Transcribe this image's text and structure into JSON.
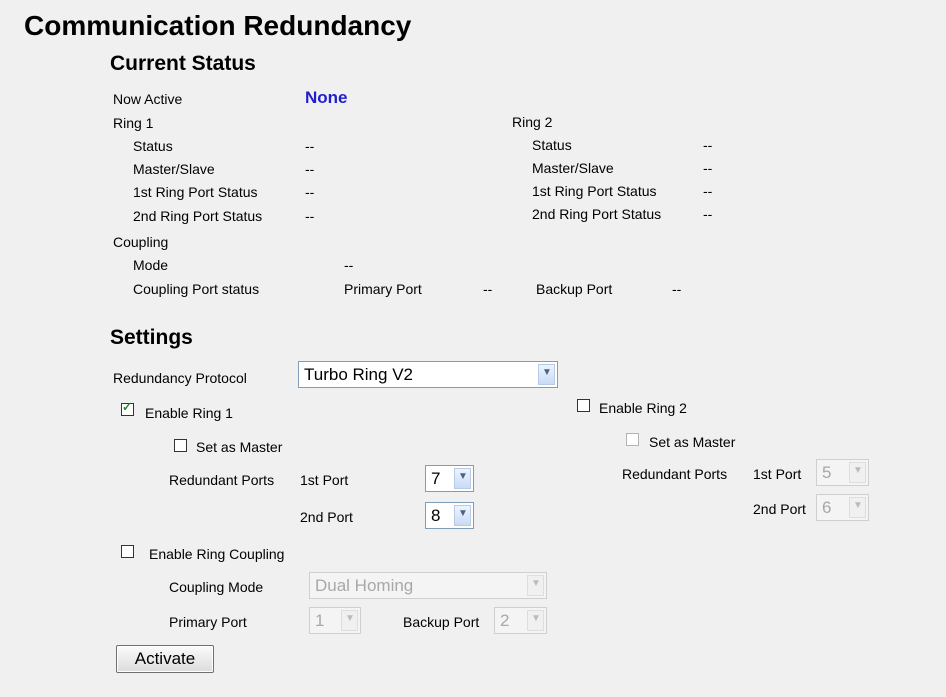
{
  "title": "Communication Redundancy",
  "status": {
    "heading": "Current Status",
    "now_active_label": "Now Active",
    "now_active_value": "None",
    "ring1": {
      "label": "Ring 1",
      "status_label": "Status",
      "status_value": "--",
      "master_label": "Master/Slave",
      "master_value": "--",
      "port1_label": "1st Ring Port Status",
      "port1_value": "--",
      "port2_label": "2nd Ring Port Status",
      "port2_value": "--"
    },
    "ring2": {
      "label": "Ring 2",
      "status_label": "Status",
      "status_value": "--",
      "master_label": "Master/Slave",
      "master_value": "--",
      "port1_label": "1st Ring Port Status",
      "port1_value": "--",
      "port2_label": "2nd Ring Port Status",
      "port2_value": "--"
    },
    "coupling": {
      "label": "Coupling",
      "mode_label": "Mode",
      "mode_value": "--",
      "port_status_label": "Coupling Port status",
      "primary_label": "Primary Port",
      "primary_value": "--",
      "backup_label": "Backup Port",
      "backup_value": "--"
    }
  },
  "settings": {
    "heading": "Settings",
    "protocol_label": "Redundancy Protocol",
    "protocol_value": "Turbo Ring V2",
    "ring1": {
      "enable_label": "Enable Ring 1",
      "enabled": true,
      "master_label": "Set as Master",
      "master_checked": false,
      "ports_label": "Redundant Ports",
      "first_label": "1st Port",
      "first_value": "7",
      "second_label": "2nd Port",
      "second_value": "8"
    },
    "ring2": {
      "enable_label": "Enable Ring 2",
      "enabled": false,
      "master_label": "Set as Master",
      "master_checked": false,
      "ports_label": "Redundant Ports",
      "first_label": "1st Port",
      "first_value": "5",
      "second_label": "2nd Port",
      "second_value": "6"
    },
    "coupling": {
      "enable_label": "Enable Ring Coupling",
      "enabled": false,
      "mode_label": "Coupling Mode",
      "mode_value": "Dual Homing",
      "primary_label": "Primary Port",
      "primary_value": "1",
      "backup_label": "Backup Port",
      "backup_value": "2"
    },
    "activate_label": "Activate"
  },
  "icons": {
    "checkmark": "check-icon",
    "dropdown": "chevron-down-icon"
  }
}
